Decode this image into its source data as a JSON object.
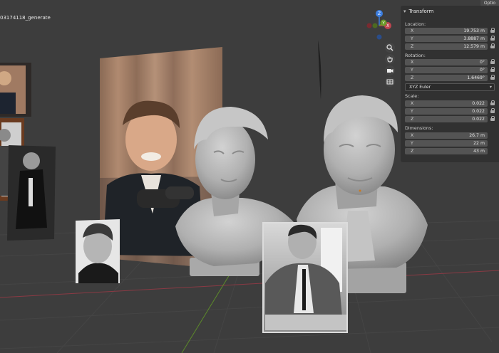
{
  "viewport": {
    "object_name": "03174118_generate"
  },
  "header": {
    "options_label": "Optio"
  },
  "gizmo_axes": {
    "z": "Z",
    "y": "Y",
    "x": "X"
  },
  "transform_panel": {
    "title": "Transform",
    "location": {
      "label": "Location:",
      "x": {
        "axis": "X",
        "value": "19.753 m"
      },
      "y": {
        "axis": "Y",
        "value": "3.8887 m"
      },
      "z": {
        "axis": "Z",
        "value": "12.579 m"
      }
    },
    "rotation": {
      "label": "Rotation:",
      "x": {
        "axis": "X",
        "value": "0°"
      },
      "y": {
        "axis": "Y",
        "value": "0°"
      },
      "z": {
        "axis": "Z",
        "value": "1.6469°"
      },
      "mode": "XYZ Euler"
    },
    "scale": {
      "label": "Scale:",
      "x": {
        "axis": "X",
        "value": "0.022"
      },
      "y": {
        "axis": "Y",
        "value": "0.022"
      },
      "z": {
        "axis": "Z",
        "value": "0.022"
      }
    },
    "dimensions": {
      "label": "Dimensions:",
      "x": {
        "axis": "X",
        "value": "26.7 m"
      },
      "y": {
        "axis": "Y",
        "value": "22 m"
      },
      "z": {
        "axis": "Z",
        "value": "43 m"
      }
    }
  },
  "colors": {
    "viewport_bg": "#3d3d3d",
    "grid_line": "#4a4a4a",
    "axis_x": "#c0444f",
    "axis_y": "#6b9a2a",
    "axis_z": "#3c7ee0",
    "bust_clay": "#b4b4b4"
  },
  "icons": [
    "zoom-icon",
    "hand-pan-icon",
    "camera-icon",
    "grid-view-icon",
    "lock-icon",
    "chevron-down-icon"
  ]
}
